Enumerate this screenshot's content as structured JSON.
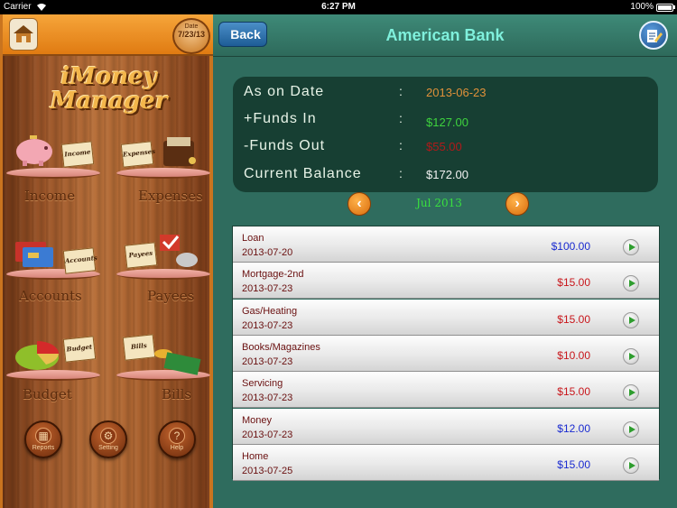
{
  "status_bar": {
    "carrier": "Carrier",
    "time": "6:27 PM",
    "battery": "100%"
  },
  "sidebar": {
    "date_label": "Date",
    "date_value": "7/23/13",
    "logo_line1": "iMoney",
    "logo_line2": "Manager",
    "menu": [
      {
        "label": "Income",
        "card": "Income"
      },
      {
        "label": "Expenses",
        "card": "Expenses"
      },
      {
        "label": "Accounts",
        "card": "Accounts"
      },
      {
        "label": "Payees",
        "card": "Payees"
      },
      {
        "label": "Budget",
        "card": "Budget"
      },
      {
        "label": "Bills",
        "card": "Bills"
      }
    ],
    "buttons": [
      {
        "label": "Reports",
        "icon": "reports-icon"
      },
      {
        "label": "Setting",
        "icon": "gear-icon"
      },
      {
        "label": "Help",
        "icon": "help-icon"
      }
    ]
  },
  "header": {
    "back_label": "Back",
    "title": "American Bank"
  },
  "summary": {
    "as_on_date_label": "As on Date",
    "as_on_date_value": "2013-06-23",
    "funds_in_label": "+Funds In",
    "funds_in_value": "$127.00",
    "funds_out_label": "-Funds Out",
    "funds_out_value": "$55.00",
    "balance_label": "Current Balance",
    "balance_value": "$172.00",
    "colon": ":"
  },
  "month_nav": {
    "label": "Jul 2013",
    "prev": "‹",
    "next": "›"
  },
  "transactions": [
    {
      "name": "Loan",
      "date": "2013-07-20",
      "amount": "$100.00",
      "type": "income"
    },
    {
      "name": "Mortgage-2nd",
      "date": "2013-07-23",
      "amount": "$15.00",
      "type": "expense"
    },
    {
      "name": "Gas/Heating",
      "date": "2013-07-23",
      "amount": "$15.00",
      "type": "expense"
    },
    {
      "name": "Books/Magazines",
      "date": "2013-07-23",
      "amount": "$10.00",
      "type": "expense"
    },
    {
      "name": "Servicing",
      "date": "2013-07-23",
      "amount": "$15.00",
      "type": "expense"
    },
    {
      "name": "Money",
      "date": "2013-07-23",
      "amount": "$12.00",
      "type": "income"
    },
    {
      "name": "Home",
      "date": "2013-07-25",
      "amount": "$15.00",
      "type": "income"
    }
  ],
  "colors": {
    "income": "#1a2bd0",
    "expense": "#c8161b",
    "date_value": "#e0913a",
    "funds_in": "#3ed33e",
    "funds_out": "#b01a1a",
    "balance": "#f2f2f2"
  }
}
